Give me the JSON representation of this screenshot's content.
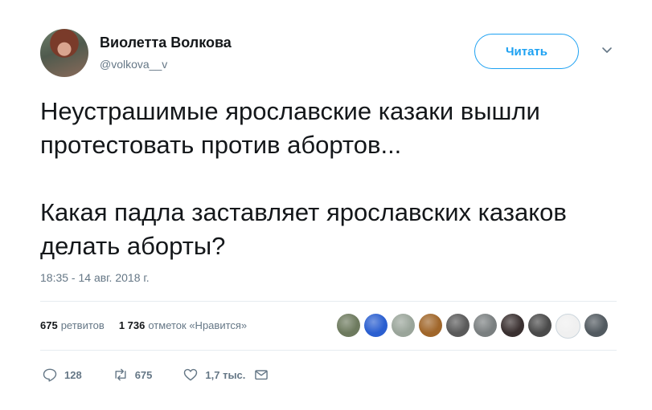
{
  "author": {
    "name": "Виолетта Волкова",
    "handle": "@volkova__v"
  },
  "follow_button": "Читать",
  "tweet": {
    "line1": "Неустрашимые ярославские казаки вышли протестовать против абортов...",
    "line2": "Какая падла заставляет ярославских казаков делать аборты?",
    "timestamp": "18:35 - 14 авг. 2018 г."
  },
  "stats": {
    "retweets_count": "675",
    "retweets_label": "ретвитов",
    "likes_count": "1 736",
    "likes_label": "отметок «Нравится»"
  },
  "liker_avatars": [
    "#6d7a5e",
    "#2b5fd0",
    "#9aa59a",
    "#a0662a",
    "#5a5a5a",
    "#7a7f80",
    "#3a3030",
    "#4a4a4a",
    "#f0f0f0",
    "#525a60"
  ],
  "actions": {
    "replies": "128",
    "retweets": "675",
    "likes": "1,7 тыс."
  },
  "colors": {
    "accent": "#1da1f2",
    "muted": "#657786",
    "text": "#14171a"
  }
}
